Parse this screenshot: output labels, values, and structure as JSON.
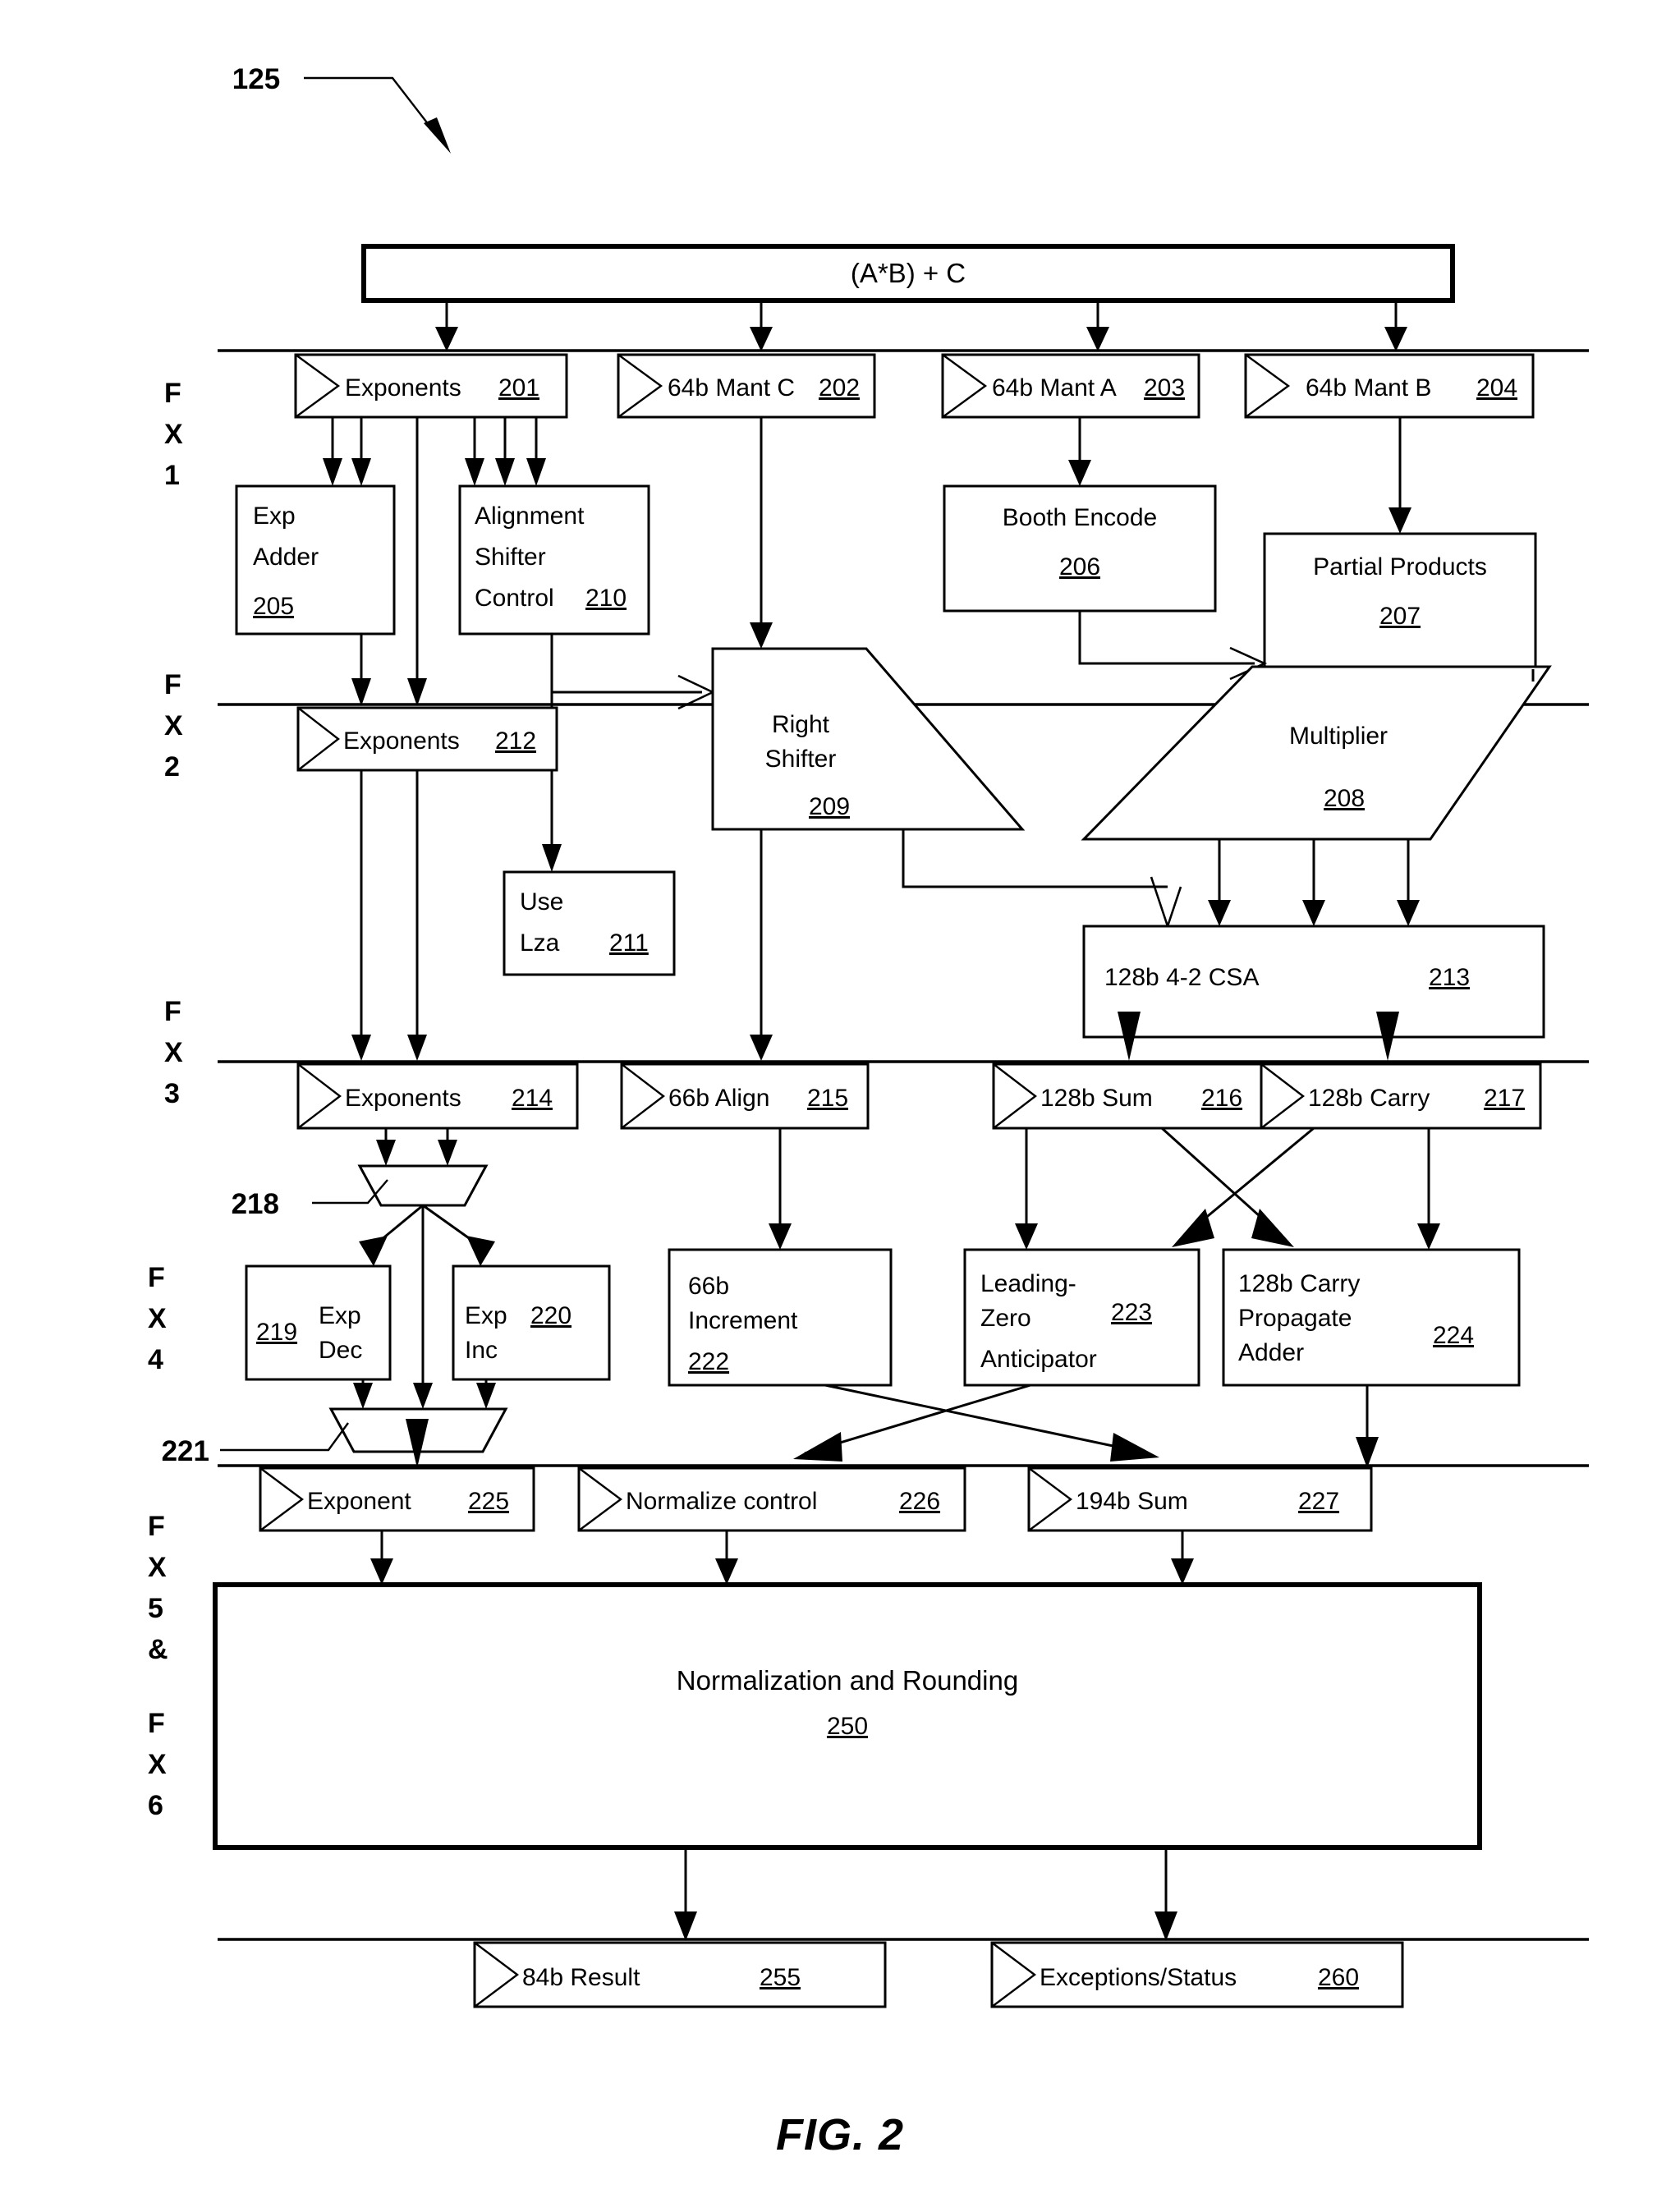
{
  "figure": {
    "caption": "FIG. 2",
    "callout_ref": "125"
  },
  "top_block": {
    "label": "(A*B) + C"
  },
  "stage_labels": [
    {
      "id": "fx1",
      "lines": [
        "F",
        "X",
        "1"
      ]
    },
    {
      "id": "fx2",
      "lines": [
        "F",
        "X",
        "2"
      ]
    },
    {
      "id": "fx3",
      "lines": [
        "F",
        "X",
        "3"
      ]
    },
    {
      "id": "fx4",
      "lines": [
        "F",
        "X",
        "4"
      ]
    },
    {
      "id": "fx56",
      "lines": [
        "F",
        "X",
        "5",
        "&",
        "F",
        "X",
        "6"
      ]
    }
  ],
  "latches_fx1": [
    {
      "label": "Exponents",
      "ref": "201"
    },
    {
      "label": "64b Mant C",
      "ref": "202"
    },
    {
      "label": "64b Mant A",
      "ref": "203"
    },
    {
      "label": "64b Mant B",
      "ref": "204"
    }
  ],
  "blocks_fx1": [
    {
      "lines": [
        "Exp",
        "Adder"
      ],
      "ref": "205"
    },
    {
      "lines": [
        "Alignment",
        "Shifter",
        "Control"
      ],
      "ref": "210",
      "ref_inline": true
    },
    {
      "lines": [
        "Booth Encode"
      ],
      "ref": "206"
    },
    {
      "lines": [
        "Partial Products"
      ],
      "ref": "207"
    }
  ],
  "latches_fx2": [
    {
      "label": "Exponents",
      "ref": "212"
    }
  ],
  "blocks_fx2": [
    {
      "lines": [
        "Use",
        "Lza"
      ],
      "ref": "211",
      "ref_inline": true
    },
    {
      "lines": [
        "Right",
        "Shifter"
      ],
      "ref": "209",
      "shape": "trapezoid-right"
    },
    {
      "lines": [
        "Multiplier"
      ],
      "ref": "208",
      "shape": "trapezoid-down"
    },
    {
      "lines": [
        "128b 4-2 CSA"
      ],
      "ref": "213",
      "ref_inline": true
    }
  ],
  "latches_fx3": [
    {
      "label": "Exponents",
      "ref": "214"
    },
    {
      "label": "66b Align",
      "ref": "215"
    },
    {
      "label": "128b Sum",
      "ref": "216"
    },
    {
      "label": "128b Carry",
      "ref": "217"
    }
  ],
  "mux_refs": [
    {
      "ref": "218"
    },
    {
      "ref": "221"
    }
  ],
  "blocks_fx4": [
    {
      "lines": [
        "Exp",
        "Dec"
      ],
      "ref": "219",
      "ref_side": "left"
    },
    {
      "lines": [
        "Exp",
        "Inc"
      ],
      "ref": "220",
      "ref_inline": true
    },
    {
      "lines": [
        "66b",
        "Increment"
      ],
      "ref": "222"
    },
    {
      "lines": [
        "Leading-",
        "Zero",
        "Anticipator"
      ],
      "ref": "223",
      "ref_inline": true
    },
    {
      "lines": [
        "128b Carry",
        "Propagate",
        "Adder"
      ],
      "ref": "224",
      "ref_inline": true
    }
  ],
  "latches_fx5": [
    {
      "label": "Exponent",
      "ref": "225"
    },
    {
      "label": "Normalize control",
      "ref": "226"
    },
    {
      "label": "194b Sum",
      "ref": "227"
    }
  ],
  "big_block": {
    "label": "Normalization and Rounding",
    "ref": "250"
  },
  "latches_out": [
    {
      "label": "84b Result",
      "ref": "255"
    },
    {
      "label": "Exceptions/Status",
      "ref": "260"
    }
  ]
}
